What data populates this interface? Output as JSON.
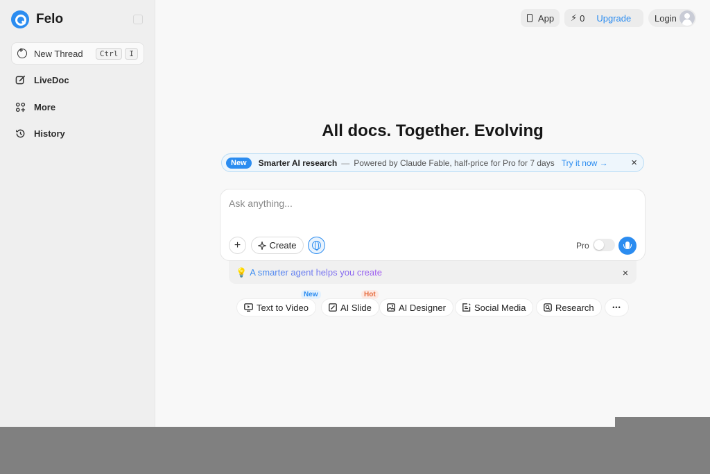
{
  "sidebar": {
    "brand": "Felo",
    "new_thread": {
      "label": "New Thread",
      "shortcut_key1": "Ctrl",
      "shortcut_key2": "I"
    },
    "items": [
      {
        "label": "LiveDoc",
        "icon": "edit-icon"
      },
      {
        "label": "More",
        "icon": "apps-icon"
      },
      {
        "label": "History",
        "icon": "history-icon"
      }
    ]
  },
  "topbar": {
    "app_label": "App",
    "credits": "0",
    "upgrade_label": "Upgrade",
    "login_label": "Login"
  },
  "headline": "All docs. Together. Evolving",
  "promo": {
    "badge": "New",
    "title": "Smarter AI research",
    "separator": "—",
    "text": "Powered by Claude Fable, half-price for Pro for 7 days",
    "cta": "Try it now →",
    "close": "×"
  },
  "composer": {
    "placeholder": "Ask anything...",
    "create_label": "Create",
    "pro_label": "Pro",
    "pro_enabled": false
  },
  "hint": {
    "emoji": "💡",
    "text": "A smarter agent helps you create",
    "close": "×"
  },
  "chips": [
    {
      "label": "Text to Video",
      "icon": "video-icon",
      "tag": "New"
    },
    {
      "label": "AI Slide",
      "icon": "slide-icon",
      "tag": "Hot"
    },
    {
      "label": "AI Designer",
      "icon": "image-icon",
      "tag": ""
    },
    {
      "label": "Social Media",
      "icon": "post-icon",
      "tag": ""
    },
    {
      "label": "Research",
      "icon": "research-icon",
      "tag": ""
    }
  ],
  "more_chips": "•••",
  "colors": {
    "accent": "#2b8cf0",
    "hot": "#e56a3c"
  }
}
